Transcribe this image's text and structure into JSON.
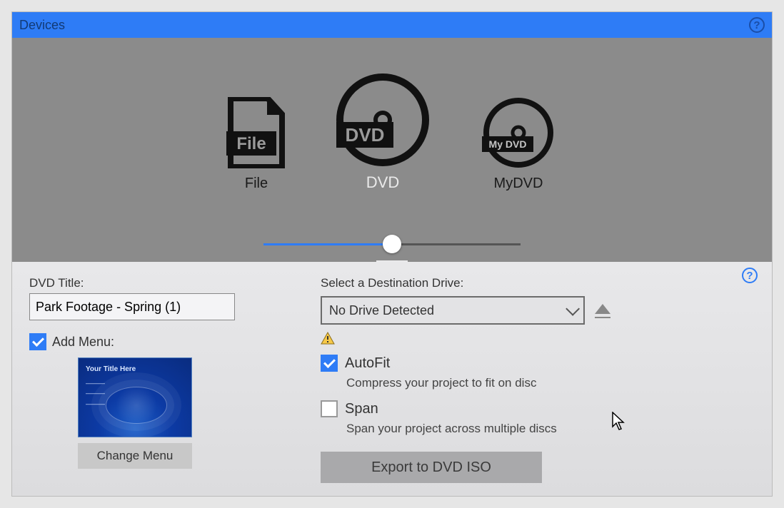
{
  "header": {
    "title": "Devices"
  },
  "devices": {
    "file_label": "File",
    "dvd_label": "DVD",
    "mydvd_label": "MyDVD",
    "file_badge": "File",
    "dvd_badge": "DVD",
    "mydvd_badge": "My DVD",
    "selected": "DVD"
  },
  "dvd": {
    "title_label": "DVD Title:",
    "title_value": "Park Footage - Spring (1)",
    "add_menu_label": "Add Menu:",
    "add_menu_checked": true,
    "change_menu_label": "Change Menu",
    "menu_preview_title": "Your Title Here"
  },
  "dest": {
    "label": "Select a Destination Drive:",
    "value": "No Drive Detected"
  },
  "options": {
    "autofit_label": "AutoFit",
    "autofit_desc": "Compress your project to fit on disc",
    "autofit_checked": true,
    "span_label": "Span",
    "span_desc": "Span your project across multiple discs",
    "span_checked": false
  },
  "actions": {
    "export_iso_label": "Export to DVD ISO"
  }
}
